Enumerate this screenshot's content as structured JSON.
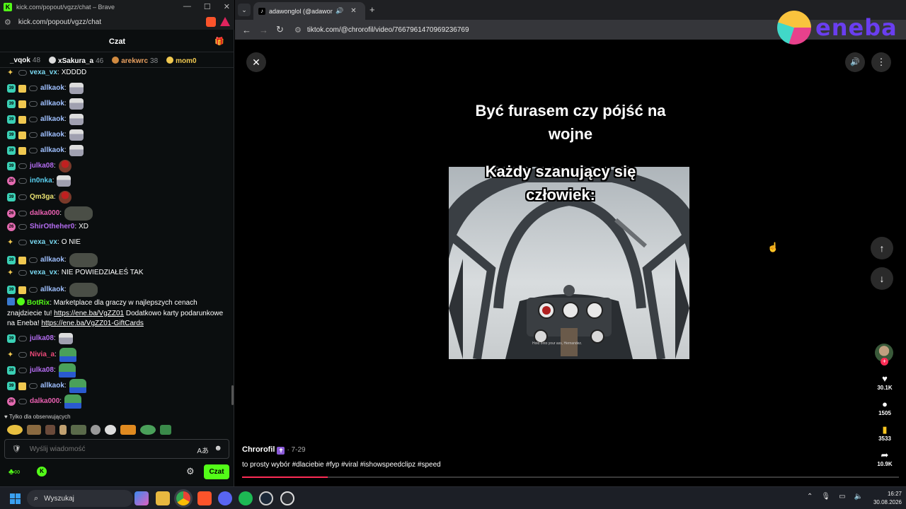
{
  "chat_window": {
    "title": "kick.com/popout/vgzz/chat – Brave",
    "url": "kick.com/popout/vgzz/chat",
    "header": "Czat",
    "leaderboard": [
      {
        "name": "_vqok",
        "count": "48"
      },
      {
        "name": "xSakura_a",
        "count": "46"
      },
      {
        "name": "arekwrc",
        "count": "38"
      },
      {
        "name": "mom0",
        "count": ""
      }
    ],
    "messages": [
      {
        "user": "vexa_vx",
        "color": "#7ad8f0",
        "text": "XDDDD",
        "emote": ""
      },
      {
        "user": "allkaok",
        "color": "#9fc0ff",
        "text": "",
        "emote": "kid"
      },
      {
        "user": "allkaok",
        "color": "#9fc0ff",
        "text": "",
        "emote": "kid"
      },
      {
        "user": "allkaok",
        "color": "#9fc0ff",
        "text": "",
        "emote": "kid"
      },
      {
        "user": "allkaok",
        "color": "#9fc0ff",
        "text": "",
        "emote": "kid"
      },
      {
        "user": "allkaok",
        "color": "#9fc0ff",
        "text": "",
        "emote": "kid"
      },
      {
        "user": "julka08",
        "color": "#b36cf0",
        "text": "",
        "emote": "mario"
      },
      {
        "user": "in0nka",
        "color": "#5ad0f0",
        "text": "",
        "emote": "kid"
      },
      {
        "user": "Qm3ga",
        "color": "#e8e070",
        "text": "",
        "emote": "mario"
      },
      {
        "user": "dalka000",
        "color": "#e860b0",
        "text": "",
        "emote": "frog"
      },
      {
        "user": "ShirOtheher0",
        "color": "#b36cf0",
        "text": "XD",
        "emote": ""
      },
      {
        "user": "vexa_vx",
        "color": "#7ad8f0",
        "text": "O NIE",
        "emote": ""
      },
      {
        "user": "allkaok",
        "color": "#9fc0ff",
        "text": "",
        "emote": "frog"
      },
      {
        "user": "vexa_vx",
        "color": "#7ad8f0",
        "text": "NIE POWIEDZIAŁEŚ TAK",
        "emote": ""
      },
      {
        "user": "allkaok",
        "color": "#9fc0ff",
        "text": "",
        "emote": "frog"
      }
    ],
    "bot_message": {
      "user": "BotRix",
      "text1": "Marketplace dla graczy w najlepszych cenach",
      "text2": "znajdziecie tu!",
      "link1": "https://ene.ba/VgZZ01",
      "text3": "Dodatkowo karty podarunkowe",
      "text4": "na Eneba!",
      "link2": "https://ene.ba/VgZZ01-GiftCards"
    },
    "messages_after": [
      {
        "user": "julka08",
        "color": "#b36cf0",
        "text": "",
        "emote": "kid"
      },
      {
        "user": "Nivia_a",
        "color": "#f04a7a",
        "text": "",
        "emote": "pepe"
      },
      {
        "user": "julka08",
        "color": "#b36cf0",
        "text": "",
        "emote": "pepe"
      },
      {
        "user": "allkaok",
        "color": "#9fc0ff",
        "text": "",
        "emote": "pepe"
      },
      {
        "user": "dalka000",
        "color": "#e860b0",
        "text": "",
        "emote": "pepe"
      }
    ],
    "followers_label": "Tylko dla obserwujących",
    "input_placeholder": "Wyślij wiadomość",
    "send_label": "Czat"
  },
  "browser": {
    "tab_title": "adawonglol (@adawonglol)",
    "url": "tiktok.com/@chrorofil/video/7667961470969236769",
    "ad_brand": "eneba"
  },
  "video": {
    "caption_top_line1": "Być furasem czy pójść na",
    "caption_top_line2": "wojne",
    "caption_mid_line1": "Każdy szanujący się",
    "caption_mid_line2": "człowiek:",
    "subtitle": "Hold onto your ass, Hernandez.",
    "author": "Chrorofil",
    "date": "· 7-29",
    "description": "to prosty wybór #dlaciebie #fyp #viral #ishowspeedclipz #speed",
    "likes": "30.1K",
    "comments": "1505",
    "saves": "3533",
    "shares": "10.9K",
    "progress": 0.13
  },
  "taskbar": {
    "search": "Wyszukaj",
    "time": "16:27",
    "date": "30.08.2026"
  }
}
